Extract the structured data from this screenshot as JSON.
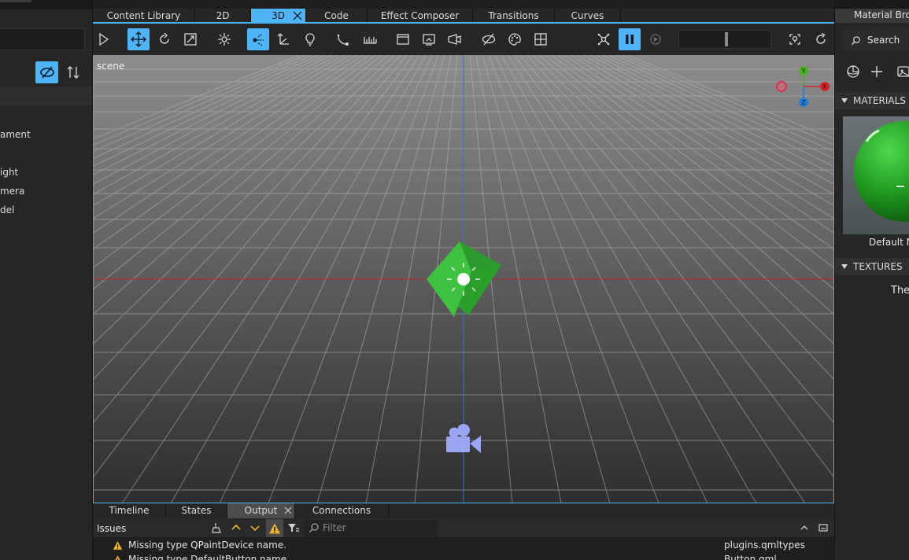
{
  "left_panel": {
    "items": [
      {
        "label": "ament"
      },
      {
        "label": "ight"
      },
      {
        "label": "mera"
      },
      {
        "label": "del"
      }
    ]
  },
  "top_tabs": [
    {
      "label": "Content Library",
      "active": false
    },
    {
      "label": "2D",
      "active": false
    },
    {
      "label": "3D",
      "active": true
    },
    {
      "label": "Code",
      "active": false
    },
    {
      "label": "Effect Composer",
      "active": false
    },
    {
      "label": "Transitions",
      "active": false
    },
    {
      "label": "Curves",
      "active": false
    }
  ],
  "viewport": {
    "scene_label": "scene",
    "gizmo": {
      "y": "Y",
      "x": "X",
      "z": "Z"
    }
  },
  "bottom_tabs": [
    {
      "label": "Timeline"
    },
    {
      "label": "States"
    },
    {
      "label": "Output"
    },
    {
      "label": "Connections"
    }
  ],
  "issues": {
    "title": "Issues",
    "filter_placeholder": "Filter",
    "rows": [
      {
        "message": "Missing type QPaintDevice name.",
        "file": "plugins.qmltypes"
      },
      {
        "message": "Missing type DefaultButton name.",
        "file": "Button.qml"
      }
    ]
  },
  "right_panel": {
    "title": "Material Brow",
    "search_label": "Search",
    "materials_header": "MATERIALS",
    "material_name": "Default M",
    "textures_header": "TEXTURES",
    "textures_text": "The"
  },
  "colors": {
    "accent": "#4fb3f7",
    "panel": "#262626",
    "warning": "#f0b429",
    "axis_x": "#d2232a",
    "axis_y": "#4caf20",
    "axis_z": "#1f7fd8"
  }
}
